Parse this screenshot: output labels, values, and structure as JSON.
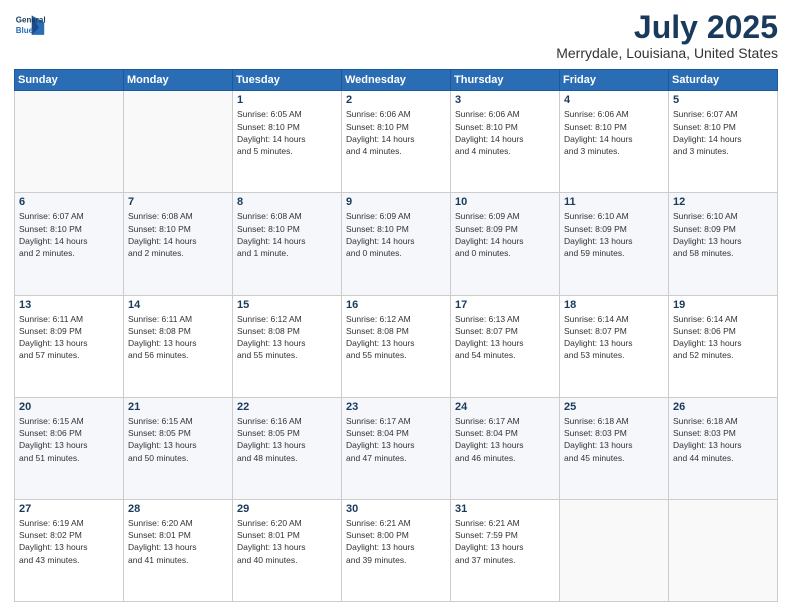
{
  "header": {
    "logo_line1": "General",
    "logo_line2": "Blue",
    "title": "July 2025",
    "subtitle": "Merrydale, Louisiana, United States"
  },
  "weekdays": [
    "Sunday",
    "Monday",
    "Tuesday",
    "Wednesday",
    "Thursday",
    "Friday",
    "Saturday"
  ],
  "weeks": [
    [
      {
        "day": "",
        "info": ""
      },
      {
        "day": "",
        "info": ""
      },
      {
        "day": "1",
        "info": "Sunrise: 6:05 AM\nSunset: 8:10 PM\nDaylight: 14 hours\nand 5 minutes."
      },
      {
        "day": "2",
        "info": "Sunrise: 6:06 AM\nSunset: 8:10 PM\nDaylight: 14 hours\nand 4 minutes."
      },
      {
        "day": "3",
        "info": "Sunrise: 6:06 AM\nSunset: 8:10 PM\nDaylight: 14 hours\nand 4 minutes."
      },
      {
        "day": "4",
        "info": "Sunrise: 6:06 AM\nSunset: 8:10 PM\nDaylight: 14 hours\nand 3 minutes."
      },
      {
        "day": "5",
        "info": "Sunrise: 6:07 AM\nSunset: 8:10 PM\nDaylight: 14 hours\nand 3 minutes."
      }
    ],
    [
      {
        "day": "6",
        "info": "Sunrise: 6:07 AM\nSunset: 8:10 PM\nDaylight: 14 hours\nand 2 minutes."
      },
      {
        "day": "7",
        "info": "Sunrise: 6:08 AM\nSunset: 8:10 PM\nDaylight: 14 hours\nand 2 minutes."
      },
      {
        "day": "8",
        "info": "Sunrise: 6:08 AM\nSunset: 8:10 PM\nDaylight: 14 hours\nand 1 minute."
      },
      {
        "day": "9",
        "info": "Sunrise: 6:09 AM\nSunset: 8:10 PM\nDaylight: 14 hours\nand 0 minutes."
      },
      {
        "day": "10",
        "info": "Sunrise: 6:09 AM\nSunset: 8:09 PM\nDaylight: 14 hours\nand 0 minutes."
      },
      {
        "day": "11",
        "info": "Sunrise: 6:10 AM\nSunset: 8:09 PM\nDaylight: 13 hours\nand 59 minutes."
      },
      {
        "day": "12",
        "info": "Sunrise: 6:10 AM\nSunset: 8:09 PM\nDaylight: 13 hours\nand 58 minutes."
      }
    ],
    [
      {
        "day": "13",
        "info": "Sunrise: 6:11 AM\nSunset: 8:09 PM\nDaylight: 13 hours\nand 57 minutes."
      },
      {
        "day": "14",
        "info": "Sunrise: 6:11 AM\nSunset: 8:08 PM\nDaylight: 13 hours\nand 56 minutes."
      },
      {
        "day": "15",
        "info": "Sunrise: 6:12 AM\nSunset: 8:08 PM\nDaylight: 13 hours\nand 55 minutes."
      },
      {
        "day": "16",
        "info": "Sunrise: 6:12 AM\nSunset: 8:08 PM\nDaylight: 13 hours\nand 55 minutes."
      },
      {
        "day": "17",
        "info": "Sunrise: 6:13 AM\nSunset: 8:07 PM\nDaylight: 13 hours\nand 54 minutes."
      },
      {
        "day": "18",
        "info": "Sunrise: 6:14 AM\nSunset: 8:07 PM\nDaylight: 13 hours\nand 53 minutes."
      },
      {
        "day": "19",
        "info": "Sunrise: 6:14 AM\nSunset: 8:06 PM\nDaylight: 13 hours\nand 52 minutes."
      }
    ],
    [
      {
        "day": "20",
        "info": "Sunrise: 6:15 AM\nSunset: 8:06 PM\nDaylight: 13 hours\nand 51 minutes."
      },
      {
        "day": "21",
        "info": "Sunrise: 6:15 AM\nSunset: 8:05 PM\nDaylight: 13 hours\nand 50 minutes."
      },
      {
        "day": "22",
        "info": "Sunrise: 6:16 AM\nSunset: 8:05 PM\nDaylight: 13 hours\nand 48 minutes."
      },
      {
        "day": "23",
        "info": "Sunrise: 6:17 AM\nSunset: 8:04 PM\nDaylight: 13 hours\nand 47 minutes."
      },
      {
        "day": "24",
        "info": "Sunrise: 6:17 AM\nSunset: 8:04 PM\nDaylight: 13 hours\nand 46 minutes."
      },
      {
        "day": "25",
        "info": "Sunrise: 6:18 AM\nSunset: 8:03 PM\nDaylight: 13 hours\nand 45 minutes."
      },
      {
        "day": "26",
        "info": "Sunrise: 6:18 AM\nSunset: 8:03 PM\nDaylight: 13 hours\nand 44 minutes."
      }
    ],
    [
      {
        "day": "27",
        "info": "Sunrise: 6:19 AM\nSunset: 8:02 PM\nDaylight: 13 hours\nand 43 minutes."
      },
      {
        "day": "28",
        "info": "Sunrise: 6:20 AM\nSunset: 8:01 PM\nDaylight: 13 hours\nand 41 minutes."
      },
      {
        "day": "29",
        "info": "Sunrise: 6:20 AM\nSunset: 8:01 PM\nDaylight: 13 hours\nand 40 minutes."
      },
      {
        "day": "30",
        "info": "Sunrise: 6:21 AM\nSunset: 8:00 PM\nDaylight: 13 hours\nand 39 minutes."
      },
      {
        "day": "31",
        "info": "Sunrise: 6:21 AM\nSunset: 7:59 PM\nDaylight: 13 hours\nand 37 minutes."
      },
      {
        "day": "",
        "info": ""
      },
      {
        "day": "",
        "info": ""
      }
    ]
  ]
}
